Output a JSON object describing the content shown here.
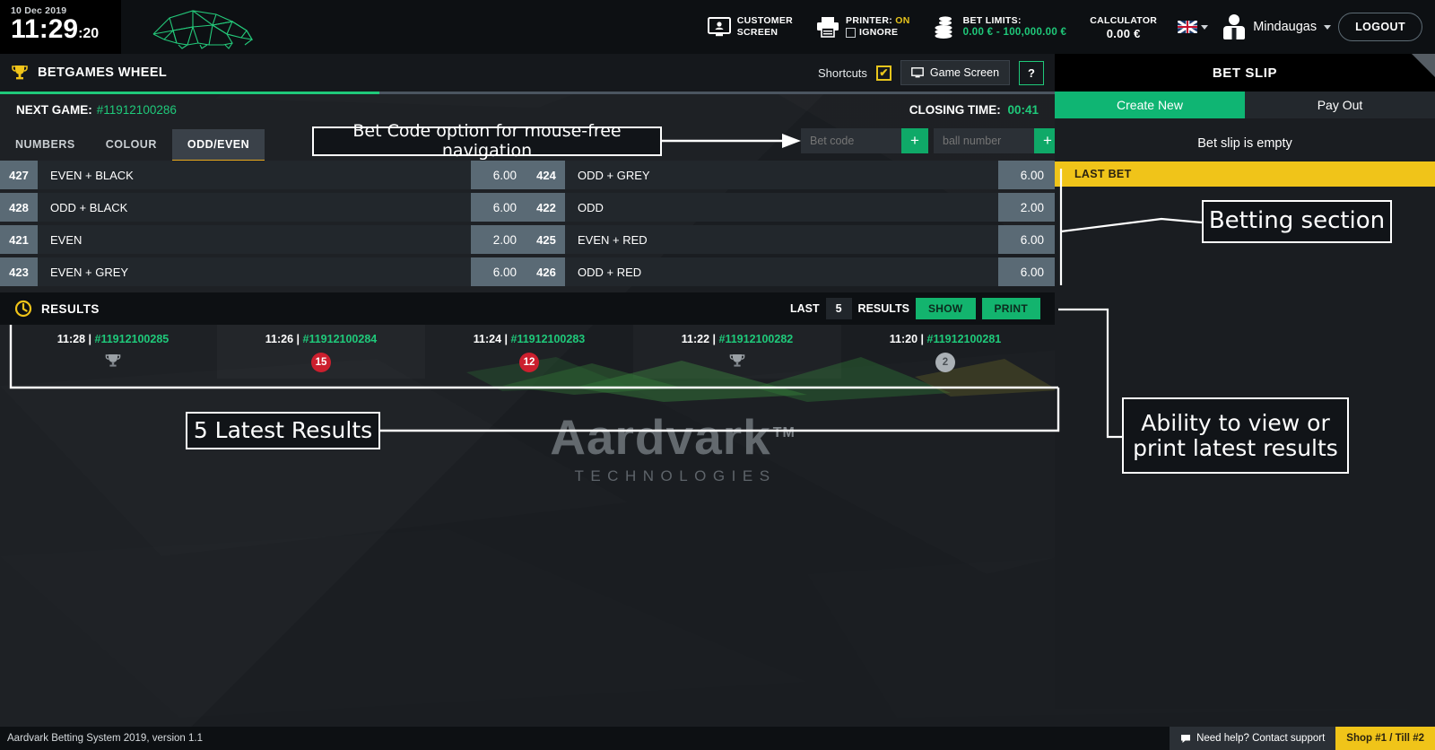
{
  "topbar": {
    "date": "10 Dec 2019",
    "time": "11:29",
    "seconds": ":20",
    "logo_name": "aardvark-logo",
    "customer_screen": {
      "line1": "CUSTOMER",
      "line2": "SCREEN"
    },
    "printer": {
      "label": "PRINTER:",
      "status": "ON",
      "ignore_label": "IGNORE"
    },
    "bet_limits": {
      "label": "BET LIMITS:",
      "value": "0.00 € - 100,000.00 €"
    },
    "calculator": {
      "label": "CALCULATOR",
      "value": "0.00 €"
    },
    "language": "en",
    "user_name": "Mindaugas",
    "logout_label": "LOGOUT"
  },
  "game": {
    "title": "BETGAMES WHEEL",
    "shortcuts_label": "Shortcuts",
    "shortcuts_checked": "✔",
    "game_screen_label": "Game Screen",
    "help_label": "?",
    "progress_percent": 36,
    "next_game_label": "NEXT GAME:",
    "next_game_id": "#11912100286",
    "closing_time_label": "CLOSING TIME:",
    "closing_time_value": "00:41",
    "tabs": [
      {
        "label": "NUMBERS",
        "active": false
      },
      {
        "label": "COLOUR",
        "active": false
      },
      {
        "label": "ODD/EVEN",
        "active": true
      }
    ],
    "bet_code": {
      "code_placeholder": "Bet code",
      "ball_placeholder": "ball number",
      "plus": "+"
    }
  },
  "bets": {
    "left": [
      {
        "num": "427",
        "name": "EVEN + BLACK",
        "odd": "6.00"
      },
      {
        "num": "428",
        "name": "ODD + BLACK",
        "odd": "6.00"
      },
      {
        "num": "421",
        "name": "EVEN",
        "odd": "2.00"
      },
      {
        "num": "423",
        "name": "EVEN + GREY",
        "odd": "6.00"
      }
    ],
    "right": [
      {
        "num": "424",
        "name": "ODD + GREY",
        "odd": "6.00"
      },
      {
        "num": "422",
        "name": "ODD",
        "odd": "2.00"
      },
      {
        "num": "425",
        "name": "EVEN + RED",
        "odd": "6.00"
      },
      {
        "num": "426",
        "name": "ODD + RED",
        "odd": "6.00"
      }
    ]
  },
  "results": {
    "title": "RESULTS",
    "last_label": "LAST",
    "count": "5",
    "results_label": "RESULTS",
    "show_label": "SHOW",
    "print_label": "PRINT",
    "items": [
      {
        "time": "11:28",
        "sep": "|",
        "id": "#11912100285",
        "ball": "",
        "ball_type": "trophy"
      },
      {
        "time": "11:26",
        "sep": "|",
        "id": "#11912100284",
        "ball": "15",
        "ball_type": "red"
      },
      {
        "time": "11:24",
        "sep": "|",
        "id": "#11912100283",
        "ball": "12",
        "ball_type": "red"
      },
      {
        "time": "11:22",
        "sep": "|",
        "id": "#11912100282",
        "ball": "",
        "ball_type": "trophy"
      },
      {
        "time": "11:20",
        "sep": "|",
        "id": "#11912100281",
        "ball": "2",
        "ball_type": "grey"
      }
    ]
  },
  "watermark": {
    "main": "Aardvark",
    "tm": "TM",
    "sub": "TECHNOLOGIES"
  },
  "betslip": {
    "title": "BET SLIP",
    "tab_create": "Create New",
    "tab_payout": "Pay Out",
    "empty_text": "Bet slip is empty",
    "last_bet_label": "LAST BET"
  },
  "footer": {
    "version": "Aardvark Betting System 2019, version 1.1",
    "support": "Need help? Contact support",
    "shop": "Shop #1 / Till #2"
  },
  "annotations": {
    "bet_code": "Bet Code option for mouse-free navigation",
    "betting_section": "Betting section",
    "latest_results": "5 Latest Results",
    "print_results_line1": "Ability to view or",
    "print_results_line2": "print latest results"
  },
  "colors": {
    "green": "#1fc97a",
    "yellow": "#f0c419",
    "red_ball": "#cc1f2e",
    "grey_ball": "#aab0b5",
    "panel": "#22272c",
    "chip": "#5a6a75"
  }
}
